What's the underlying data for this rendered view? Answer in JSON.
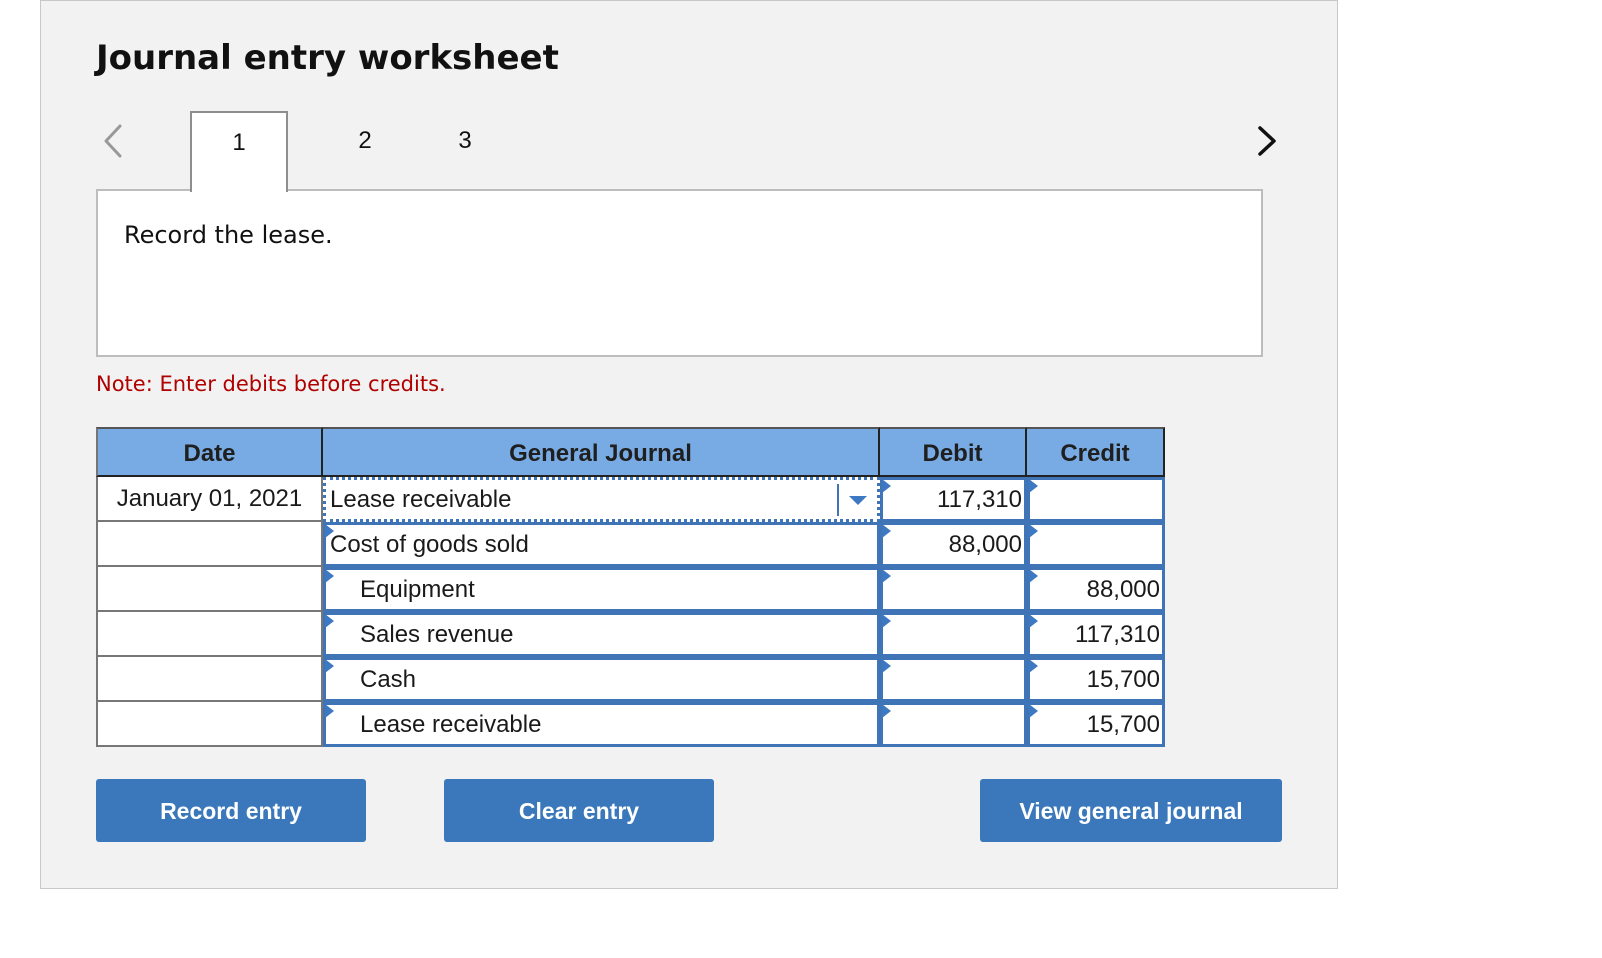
{
  "title": "Journal entry worksheet",
  "pagination": {
    "tabs": [
      "1",
      "2",
      "3"
    ],
    "active_index": 0,
    "prev_icon": "chevron-left-icon",
    "next_icon": "chevron-right-icon"
  },
  "instruction": "Record the lease.",
  "note": "Note: Enter debits before credits.",
  "journal": {
    "headers": {
      "date": "Date",
      "account": "General Journal",
      "debit": "Debit",
      "credit": "Credit"
    },
    "rows": [
      {
        "date": "January 01, 2021",
        "account": "Lease receivable",
        "debit": "117,310",
        "credit": ""
      },
      {
        "date": "",
        "account": "Cost of goods sold",
        "debit": "88,000",
        "credit": ""
      },
      {
        "date": "",
        "account": "Equipment",
        "debit": "",
        "credit": "88,000"
      },
      {
        "date": "",
        "account": "Sales revenue",
        "debit": "",
        "credit": "117,310"
      },
      {
        "date": "",
        "account": "Cash",
        "debit": "",
        "credit": "15,700"
      },
      {
        "date": "",
        "account": "Lease receivable",
        "debit": "",
        "credit": "15,700"
      }
    ]
  },
  "buttons": {
    "record": "Record entry",
    "clear": "Clear entry",
    "view": "View general journal"
  },
  "colors": {
    "header_bg": "#78abe3",
    "button_bg": "#3a78bb",
    "note_red": "#b00000",
    "input_border": "#3f74b6"
  }
}
